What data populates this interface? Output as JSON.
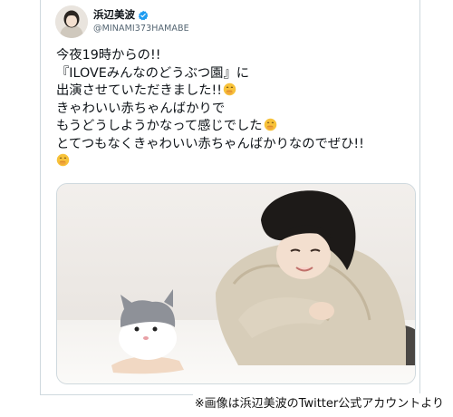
{
  "user": {
    "display_name": "浜辺美波",
    "handle": "@MINAMI373HAMABE",
    "verified_icon": "verified-badge-icon",
    "verified_color": "#1d9bf0"
  },
  "tweet": {
    "lines": [
      "今夜19時からの!!",
      "『ILOVEみんなのどうぶつ園』に",
      "出演させていただきました!!",
      "きゃわいい赤ちゃんばかりで",
      "もうどうしようかなって感じでした",
      "とてつもなくきゃわいい赤ちゃんばかりなのでぜひ!!"
    ],
    "emoji_icon": "face-with-hand-over-mouth-icon"
  },
  "media": {
    "image_icon": "photo-woman-with-kitten-icon"
  },
  "caption": {
    "credit": "※画像は浜辺美波のTwitter公式アカウントより"
  },
  "colors": {
    "text": "#0f1419",
    "secondary": "#536471",
    "border": "#cfd9de"
  }
}
